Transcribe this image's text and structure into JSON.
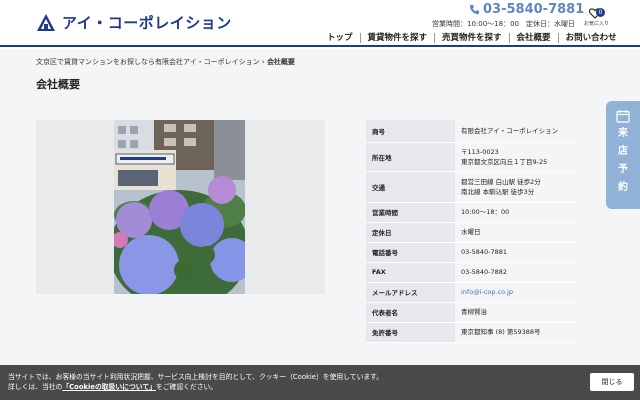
{
  "header": {
    "logo_text": "アイ・コーポレイション",
    "logo_icon": "roof-house-logo",
    "phone_icon": "phone-icon",
    "phone": "03-5840-7881",
    "hours": "営業時間：10:00～18：00　定休日：水曜日",
    "favorites_label": "お気に入り",
    "favorites_count": "0",
    "nav": [
      "トップ",
      "賃貸物件を探す",
      "売買物件を探す",
      "会社概要",
      "お問い合わせ"
    ]
  },
  "breadcrumb": {
    "parent": "文京区で賃貸マンションをお探しなら有限会社アイ・コーポレイション",
    "separator": "›",
    "current": "会社概要"
  },
  "page_title": "会社概要",
  "company": {
    "rows": [
      {
        "label": "商号",
        "lines": [
          "有限会社アイ・コーポレイション"
        ]
      },
      {
        "label": "所在地",
        "lines": [
          "〒113-0023",
          "東京都文京区向丘１丁目9-25"
        ]
      },
      {
        "label": "交通",
        "lines": [
          "都営三田線 白山駅 徒歩2分",
          "南北線 本駒込駅 徒歩3分"
        ]
      },
      {
        "label": "営業時間",
        "lines": [
          "10:00～18：00"
        ]
      },
      {
        "label": "定休日",
        "lines": [
          "水曜日"
        ]
      },
      {
        "label": "電話番号",
        "lines": [
          "03-5840-7881"
        ]
      },
      {
        "label": "FAX",
        "lines": [
          "03-5840-7882"
        ]
      },
      {
        "label": "メールアドレス",
        "lines": [
          "info@i-cop.co.jp"
        ]
      },
      {
        "label": "代表者名",
        "lines": [
          "青柳賢治"
        ]
      },
      {
        "label": "免許番号",
        "lines": [
          "東京都知事 (8) 第59388号"
        ]
      }
    ]
  },
  "side_tab": {
    "icon": "calendar-icon",
    "chars": [
      "来",
      "店",
      "予",
      "約"
    ]
  },
  "cookie": {
    "line1": "当サイトでは、お客様の当サイト利用状況把握、サービス向上検討を目的として、クッキー（Cookie）を使用しています。",
    "line2_prefix": "詳しくは、当社の",
    "link": "「Cookieの取扱いについて」",
    "line2_suffix": "をご確認ください。",
    "close_label": "閉じる"
  },
  "colors": {
    "brand": "#1f3b86",
    "phone": "#5d86c4",
    "side_tab": "#8fb2d6",
    "link": "#3b6fc8",
    "cookie_bg": "#4a4a4a"
  }
}
